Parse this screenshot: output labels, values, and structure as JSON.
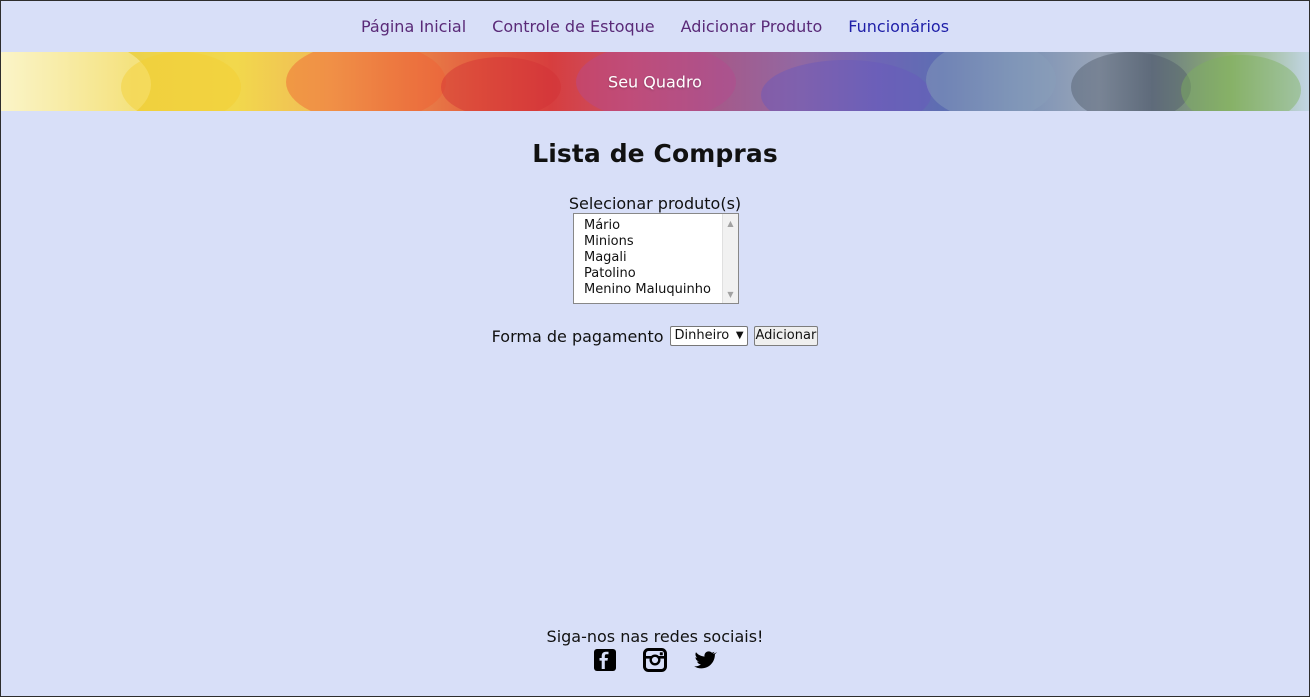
{
  "nav": {
    "items": [
      {
        "label": "Página Inicial"
      },
      {
        "label": "Controle de Estoque"
      },
      {
        "label": "Adicionar Produto"
      },
      {
        "label": "Funcionários"
      }
    ]
  },
  "banner": {
    "title": "Seu Quadro"
  },
  "page": {
    "heading": "Lista de Compras",
    "select_label": "Selecionar produto(s)",
    "products": [
      "Mário",
      "Minions",
      "Magali",
      "Patolino",
      "Menino Maluquinho"
    ],
    "payment_label": "Forma de pagamento",
    "payment_selected": "Dinheiro",
    "add_button": "Adicionar"
  },
  "footer": {
    "text": "Siga-nos nas redes sociais!",
    "icons": [
      {
        "name": "facebook-icon"
      },
      {
        "name": "instagram-icon"
      },
      {
        "name": "twitter-icon"
      }
    ]
  },
  "colors": {
    "background": "#d8dff8",
    "nav_link": "#5a2a78",
    "nav_link_current": "#1f1fa8"
  }
}
